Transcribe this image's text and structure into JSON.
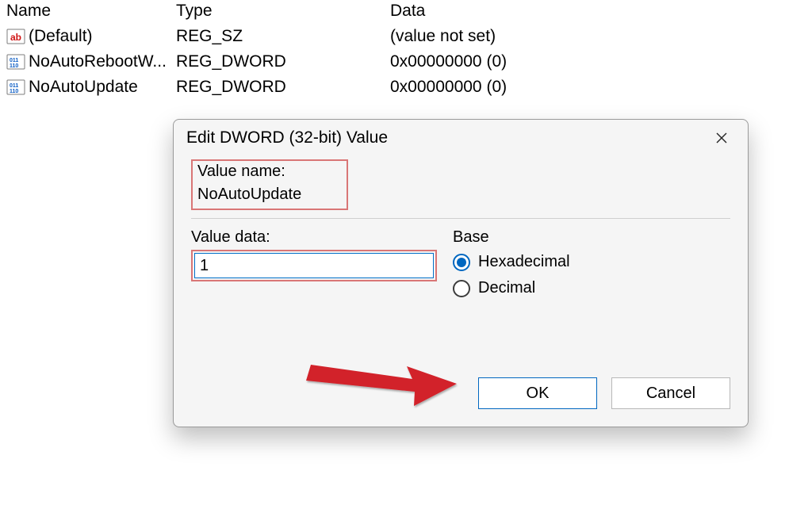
{
  "registry": {
    "columns": {
      "name": "Name",
      "type": "Type",
      "data": "Data"
    },
    "rows": [
      {
        "name": "(Default)",
        "type": "REG_SZ",
        "data": "(value not set)",
        "kind": "sz"
      },
      {
        "name": "NoAutoRebootW...",
        "type": "REG_DWORD",
        "data": "0x00000000 (0)",
        "kind": "dword"
      },
      {
        "name": "NoAutoUpdate",
        "type": "REG_DWORD",
        "data": "0x00000000 (0)",
        "kind": "dword"
      }
    ]
  },
  "dialog": {
    "title": "Edit DWORD (32-bit) Value",
    "value_name_label": "Value name:",
    "value_name": "NoAutoUpdate",
    "value_data_label": "Value data:",
    "value_data": "1",
    "base_label": "Base",
    "radio_hex": "Hexadecimal",
    "radio_dec": "Decimal",
    "ok": "OK",
    "cancel": "Cancel"
  }
}
